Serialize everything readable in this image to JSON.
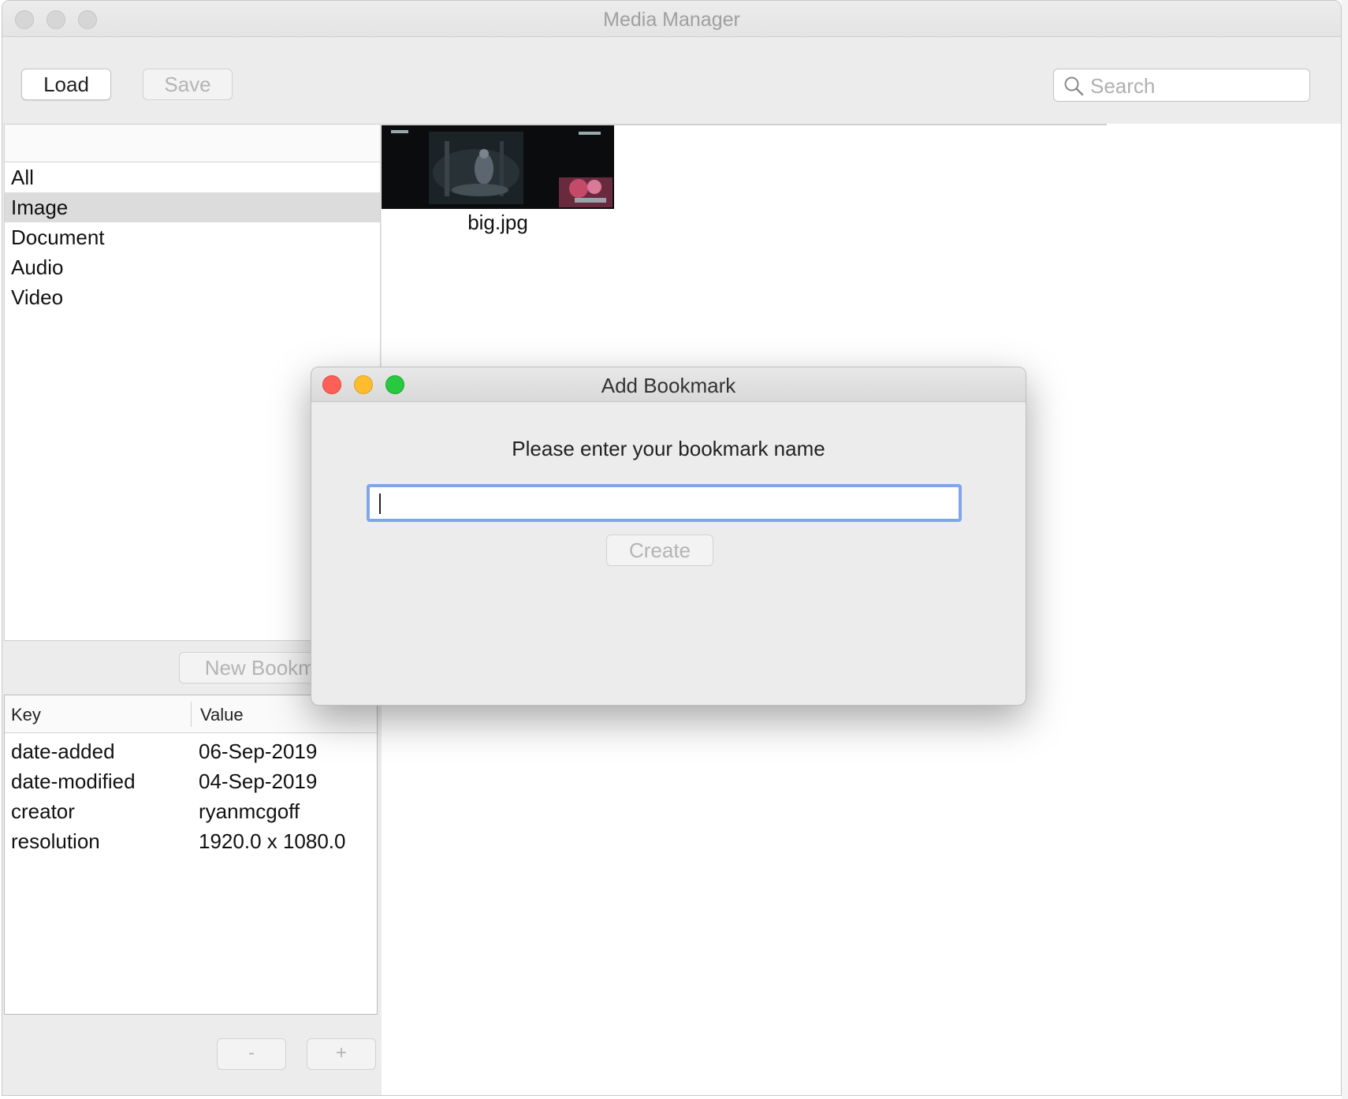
{
  "window": {
    "title": "Media Manager"
  },
  "toolbar": {
    "load_label": "Load",
    "save_label": "Save",
    "search_placeholder": "Search"
  },
  "categories": [
    {
      "label": "All",
      "selected": false
    },
    {
      "label": "Image",
      "selected": true
    },
    {
      "label": "Document",
      "selected": false
    },
    {
      "label": "Audio",
      "selected": false
    },
    {
      "label": "Video",
      "selected": false
    }
  ],
  "bookmarks": {
    "new_label": "New Bookma"
  },
  "properties": {
    "columns": [
      "Key",
      "Value"
    ],
    "rows": [
      {
        "key": "date-added",
        "value": "06-Sep-2019"
      },
      {
        "key": "date-modified",
        "value": "04-Sep-2019"
      },
      {
        "key": "creator",
        "value": "ryanmcgoff"
      },
      {
        "key": "resolution",
        "value": "1920.0 x  1080.0"
      }
    ],
    "remove_label": "-",
    "add_label": "+"
  },
  "media": [
    {
      "filename": "big.jpg",
      "thumb_icon": "image-thumbnail"
    }
  ],
  "dialog": {
    "title": "Add Bookmark",
    "prompt": "Please enter your bookmark name",
    "input_value": "",
    "create_label": "Create",
    "colors": {
      "close": "#fe5f57",
      "minimize": "#febc2e",
      "zoom": "#28c840",
      "focus": "#7ea6e8"
    }
  }
}
